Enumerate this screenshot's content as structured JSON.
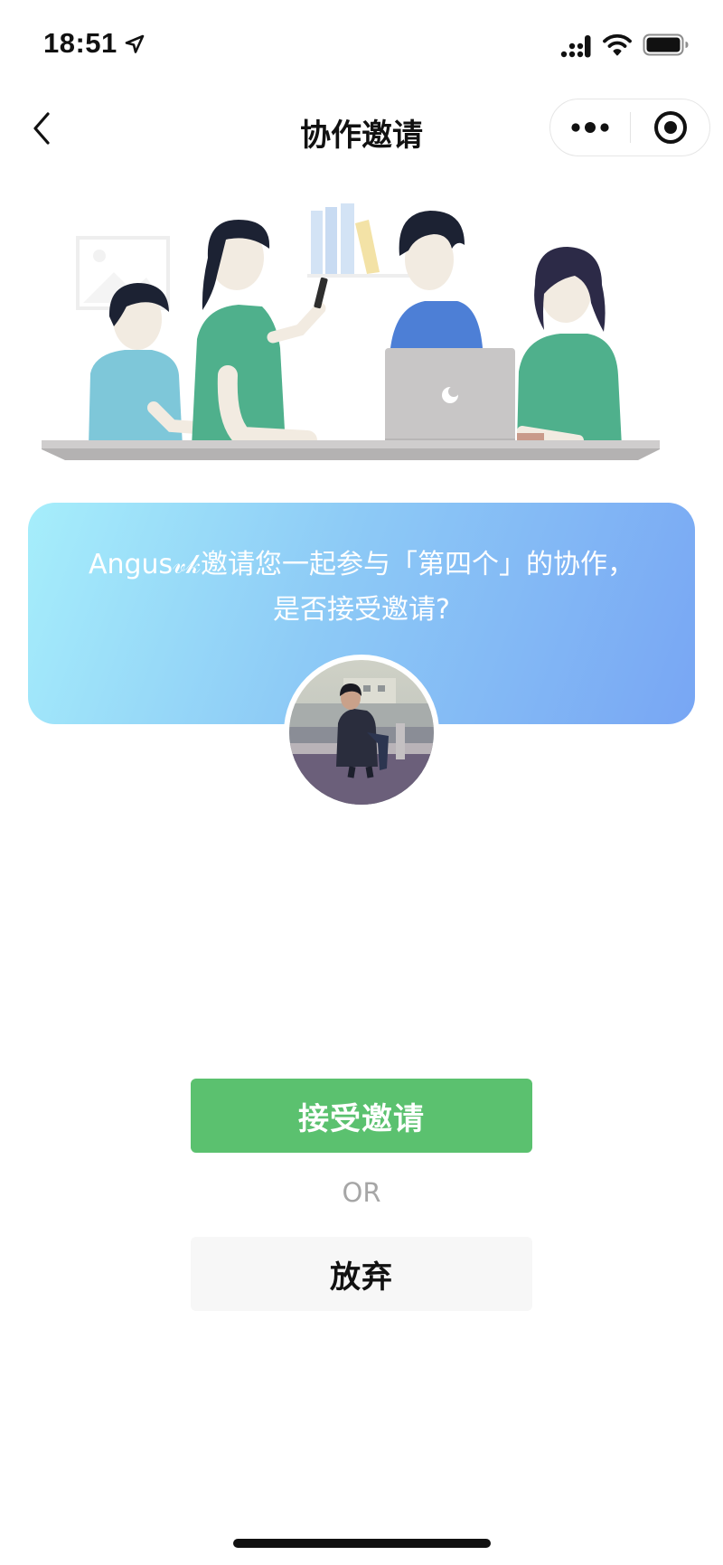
{
  "status_bar": {
    "time": "18:51",
    "icons": [
      "location-arrow-icon",
      "signal-icon",
      "wifi-icon",
      "battery-icon"
    ]
  },
  "nav": {
    "title": "协作邀请",
    "icons": [
      "back-chevron-icon",
      "more-dots-icon",
      "close-target-icon"
    ]
  },
  "invite": {
    "message": "Angus𝓋𝓀邀请您一起参与「第四个」的协作，是否接受邀请?"
  },
  "actions": {
    "accept_label": "接受邀请",
    "or_label": "OR",
    "decline_label": "放弃"
  },
  "colors": {
    "accent_green": "#5bc16f",
    "card_gradient_start": "#a6eefb",
    "card_gradient_end": "#78a6f4",
    "decline_bg": "#f7f7f7",
    "or_text": "#a6a6a6"
  }
}
